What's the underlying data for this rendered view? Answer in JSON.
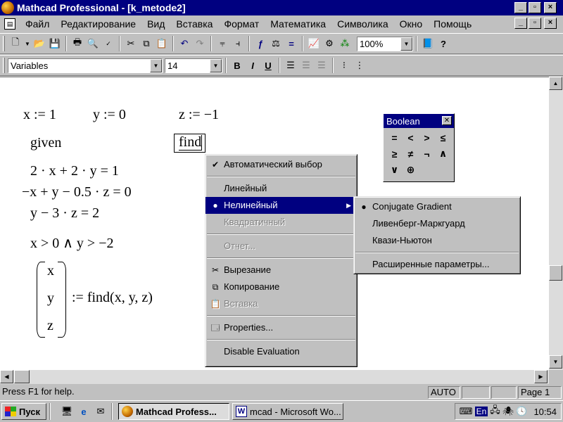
{
  "window": {
    "title": "Mathcad Professional - [k_metode2]",
    "controls": [
      "_",
      "▫",
      "×"
    ]
  },
  "menubar": {
    "items": [
      "Файл",
      "Редактирование",
      "Вид",
      "Вставка",
      "Формат",
      "Математика",
      "Символика",
      "Окно",
      "Помощь"
    ]
  },
  "toolbar": {
    "zoom": "100%",
    "style": "Variables",
    "font_size": "14",
    "bold": "B",
    "italic": "I",
    "underline": "U"
  },
  "worksheet": {
    "def_x": "x := 1",
    "def_y": "y := 0",
    "def_z": "z := −1",
    "given": "given",
    "find": "find",
    "eq1": "2 · x + 2 · y = 1",
    "eq2": "−x + y − 0.5 · z = 0",
    "eq3": "y − 3 · z = 2",
    "constraint": "x > 0 ∧ y > −2",
    "vec_x": "x",
    "vec_y": "y",
    "vec_z": "z",
    "solve": ":= find(x, y, z)"
  },
  "boolean_palette": {
    "title": "Boolean",
    "symbols": [
      "=",
      "<",
      ">",
      "≤",
      "≥",
      "≠",
      "¬",
      "∧",
      "∨",
      "⊕"
    ]
  },
  "context_menu": {
    "auto": "Автоматический выбор",
    "linear": "Линейный",
    "nonlinear": "Нелинейный",
    "quadratic": "Квадратичный",
    "report": "Отчет...",
    "cut": "Вырезание",
    "copy": "Копирование",
    "paste": "Вставка",
    "properties": "Properties...",
    "disable_eval": "Disable Evaluation"
  },
  "submenu": {
    "conjugate": "Conjugate Gradient",
    "levenberg": "Ливенберг-Маркгуард",
    "quasi_newton": "Квази-Ньютон",
    "advanced": "Расширенные параметры..."
  },
  "statusbar": {
    "help": "Press F1 for help.",
    "mode": "AUTO",
    "page": "Page 1"
  },
  "taskbar": {
    "start": "Пуск",
    "task_mathcad": "Mathcad Profess...",
    "task_word": "mcad - Microsoft Wo...",
    "lang": "En",
    "time": "10:54"
  }
}
